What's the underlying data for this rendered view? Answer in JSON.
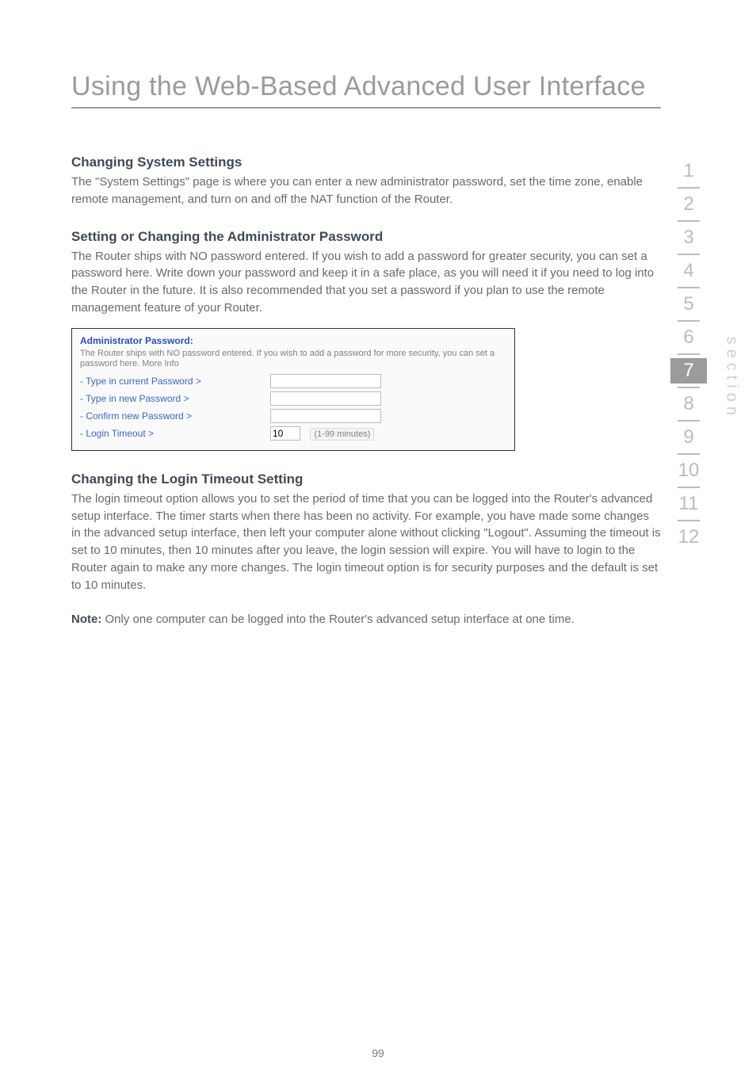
{
  "page": {
    "title": "Using the Web-Based Advanced User Interface",
    "number": "99"
  },
  "sections": {
    "changing_system": {
      "heading": "Changing System Settings",
      "body": "The \"System Settings\" page is where you can enter a new administrator password, set the time zone, enable remote management, and turn on and off the NAT function of the Router."
    },
    "admin_password": {
      "heading": "Setting or Changing the Administrator Password",
      "body": "The Router ships with NO password entered. If you wish to add a password for greater security, you can set a password here. Write down your password and keep it in a safe place, as you will need it if you need to log into the Router in the future. It is also recommended that you set a password if you plan to use the remote management feature of your Router."
    },
    "login_timeout": {
      "heading": "Changing the Login Timeout Setting",
      "body": "The login timeout option allows you to set the period of time that you can be logged into the Router's advanced setup interface. The timer starts when there has been no activity. For example, you have made some changes in the advanced setup interface, then left your computer alone without clicking \"Logout\". Assuming the timeout is set to 10 minutes, then 10 minutes after you leave, the login session will expire. You will have to login to the Router again to make any more changes. The login timeout option is for security purposes and the default is set to 10 minutes."
    },
    "note": {
      "label": "Note:",
      "body": " Only one computer can be logged into the Router's advanced setup interface at one time."
    }
  },
  "panel": {
    "title": "Administrator Password:",
    "desc": "The Router ships with NO password entered. If you wish to add a password for more security, you can set a password here. More Info",
    "rows": {
      "current": "- Type in current Password >",
      "new": "- Type in new Password >",
      "confirm": "- Confirm new Password >",
      "timeout": "- Login Timeout >"
    },
    "timeout_value": "10",
    "timeout_hint": "(1-99 minutes)"
  },
  "sidenav": {
    "items": [
      "1",
      "2",
      "3",
      "4",
      "5",
      "6",
      "7",
      "8",
      "9",
      "10",
      "11",
      "12"
    ],
    "active_index": 6,
    "label": "section"
  }
}
